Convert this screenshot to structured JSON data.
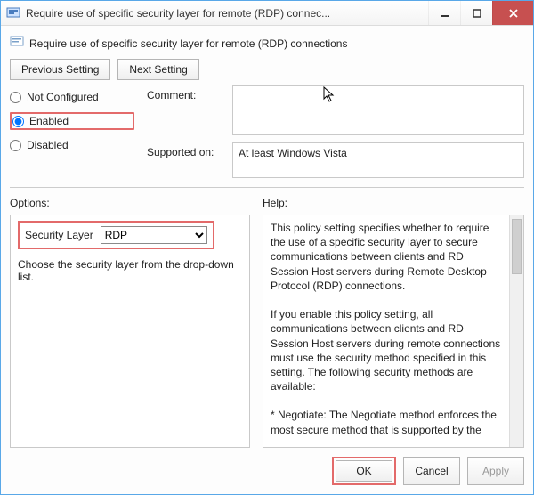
{
  "titlebar": {
    "title": "Require use of specific security layer for remote (RDP) connec..."
  },
  "subheader": {
    "title": "Require use of specific security layer for remote (RDP) connections"
  },
  "nav": {
    "prev_label": "Previous Setting",
    "next_label": "Next Setting"
  },
  "state_radios": {
    "not_configured": "Not Configured",
    "enabled": "Enabled",
    "disabled": "Disabled",
    "selected": "enabled"
  },
  "fields": {
    "comment_label": "Comment:",
    "comment_value": "",
    "supported_label": "Supported on:",
    "supported_value": "At least Windows Vista"
  },
  "options": {
    "header": "Options:",
    "security_layer_label": "Security Layer",
    "security_layer_value": "RDP",
    "hint": "Choose the security layer from the drop-down list."
  },
  "help": {
    "header": "Help:",
    "text": "This policy setting specifies whether to require the use of a specific security layer to secure communications between clients and RD Session Host servers during Remote Desktop Protocol (RDP) connections.\n\nIf you enable this policy setting, all communications between clients and RD Session Host servers during remote connections must use the security method specified in this setting. The following security methods are available:\n\n* Negotiate: The Negotiate method enforces the most secure method that is supported by the"
  },
  "footer": {
    "ok": "OK",
    "cancel": "Cancel",
    "apply": "Apply"
  },
  "icons": {
    "app": "gpo-icon",
    "minimize": "minimize-icon",
    "maximize": "maximize-icon",
    "close": "close-icon"
  }
}
